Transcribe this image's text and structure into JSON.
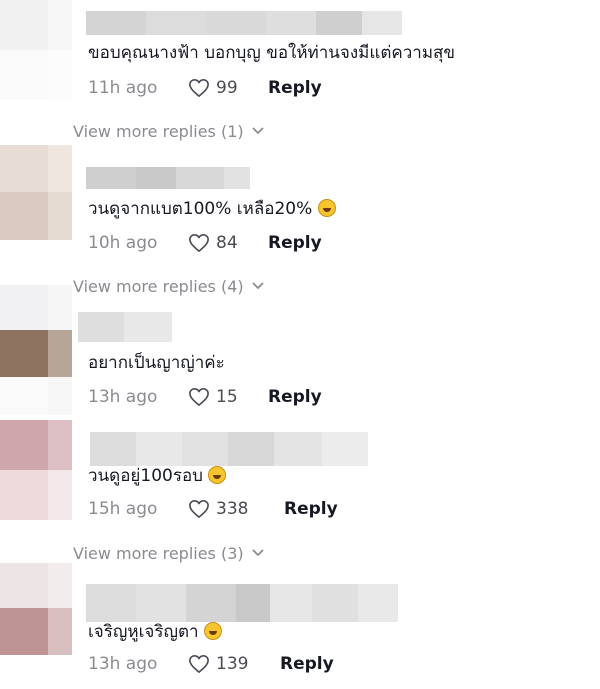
{
  "comments": [
    {
      "text": "ขอบคุณนางฟ้า บอกบุญ ขอให้ท่านจงมีแต่ความสุข",
      "time": "11h ago",
      "likes": "99",
      "reply": "Reply",
      "emoji": ""
    },
    {
      "text": "วนดูจากแบต100% เหลือ20%",
      "time": "10h ago",
      "likes": "84",
      "reply": "Reply",
      "emoji": "joy-emoji"
    },
    {
      "text": "อยากเป็นญาญ่าค่ะ",
      "time": "13h ago",
      "likes": "15",
      "reply": "Reply",
      "emoji": ""
    },
    {
      "text": "วนดูอยู่100รอบ",
      "time": "15h ago",
      "likes": "338",
      "reply": "Reply",
      "emoji": "joy-emoji"
    },
    {
      "text": "เจริญหูเจริญตา",
      "time": "13h ago",
      "likes": "139",
      "reply": "Reply",
      "emoji": "grin-emoji"
    }
  ],
  "view_more": [
    "View more replies (1)",
    "View more replies (4)",
    "View more replies (3)"
  ],
  "colors": {
    "text": "#161823",
    "muted": "#8a8b91",
    "emoji": "#f7c52e"
  }
}
